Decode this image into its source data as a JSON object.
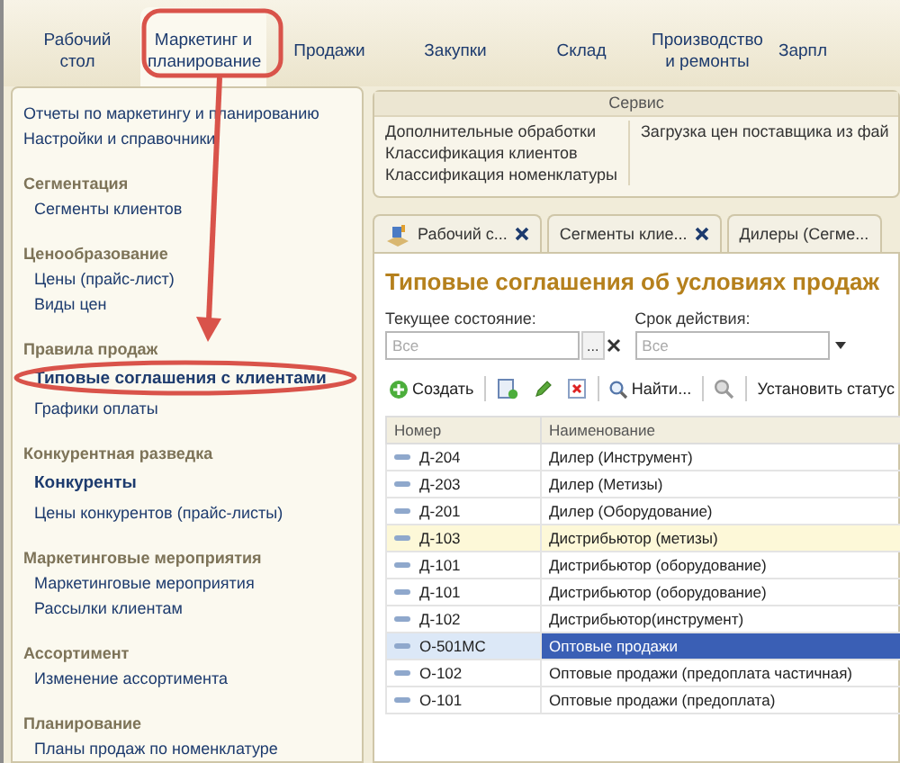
{
  "nav_tabs": [
    {
      "label": "Рабочий\nстол",
      "selected": false
    },
    {
      "label": "Маркетинг и\nпланирование",
      "selected": true
    },
    {
      "label": "Продажи",
      "selected": false
    },
    {
      "label": "Закупки",
      "selected": false
    },
    {
      "label": "Склад",
      "selected": false
    },
    {
      "label": "Производство\nи ремонты",
      "selected": false
    },
    {
      "label": "Зарпл",
      "selected": false
    }
  ],
  "sidebar": {
    "links": [
      "Отчеты по маркетингу и планированию",
      "Настройки и справочники"
    ],
    "groups": [
      {
        "title": "Сегментация",
        "items": [
          {
            "label": "Сегменты клиентов",
            "bold": false
          }
        ]
      },
      {
        "title": "Ценообразование",
        "items": [
          {
            "label": "Цены (прайс-лист)",
            "bold": false
          },
          {
            "label": "Виды цен",
            "bold": false
          }
        ]
      },
      {
        "title": "Правила продаж",
        "items": [
          {
            "label": "Типовые соглашения с клиентами",
            "bold": true
          },
          {
            "label": "Графики оплаты",
            "bold": false
          }
        ]
      },
      {
        "title": "Конкурентная разведка",
        "items": [
          {
            "label": "Конкуренты",
            "bold": true
          },
          {
            "label": "Цены конкурентов (прайс-листы)",
            "bold": false
          }
        ]
      },
      {
        "title": "Маркетинговые мероприятия",
        "items": [
          {
            "label": "Маркетинговые мероприятия",
            "bold": false
          },
          {
            "label": "Рассылки клиентам",
            "bold": false
          }
        ]
      },
      {
        "title": "Ассортимент",
        "items": [
          {
            "label": "Изменение ассортимента",
            "bold": false
          }
        ]
      },
      {
        "title": "Планирование",
        "items": [
          {
            "label": "Планы продаж по номенклатуре",
            "bold": false
          }
        ]
      }
    ]
  },
  "service": {
    "title": "Сервис",
    "columns": [
      [
        "Дополнительные обработки",
        "Классификация клиентов",
        "Классификация номенклатуры"
      ],
      [
        "Загрузка цен поставщика из фай"
      ]
    ]
  },
  "doc_tabs": [
    {
      "label": "Рабочий с...",
      "kind": "home",
      "closable": true
    },
    {
      "label": "Сегменты клие...",
      "kind": "plain",
      "closable": true
    },
    {
      "label": "Дилеры (Сегме...",
      "kind": "plain",
      "closable": false
    }
  ],
  "form": {
    "title": "Типовые соглашения об условиях продаж",
    "filters": [
      {
        "label": "Текущее состояние:",
        "placeholder": "Все",
        "kind": "select-list",
        "button": "..."
      },
      {
        "label": "Срок действия:",
        "placeholder": "Все",
        "kind": "dropdown"
      }
    ],
    "toolbar": [
      {
        "kind": "create",
        "label": "Создать"
      },
      {
        "kind": "copy"
      },
      {
        "kind": "edit"
      },
      {
        "kind": "delete"
      },
      {
        "kind": "find",
        "label": "Найти..."
      },
      {
        "kind": "cancel-find"
      },
      {
        "kind": "text",
        "label": "Установить статус"
      }
    ],
    "table": {
      "columns": [
        "Номер",
        "Наименование"
      ],
      "rows": [
        {
          "number": "Д-204",
          "name": "Дилер (Инструмент)",
          "selected": false,
          "highlighted": false
        },
        {
          "number": "Д-203",
          "name": "Дилер (Метизы)",
          "selected": false,
          "highlighted": false
        },
        {
          "number": "Д-201",
          "name": "Дилер (Оборудование)",
          "selected": false,
          "highlighted": false
        },
        {
          "number": "Д-103",
          "name": "Дистрибьютор (метизы)",
          "selected": false,
          "highlighted": true
        },
        {
          "number": "Д-101",
          "name": "Дистрибьютор (оборудование)",
          "selected": false,
          "highlighted": false
        },
        {
          "number": "Д-101",
          "name": "Дистрибьютор (оборудование)",
          "selected": false,
          "highlighted": false
        },
        {
          "number": "Д-102",
          "name": "Дистрибьютор(инструмент)",
          "selected": false,
          "highlighted": false
        },
        {
          "number": "О-501МС",
          "name": "Оптовые продажи",
          "selected": true,
          "highlighted": false
        },
        {
          "number": "О-102",
          "name": "Оптовые продажи (предоплата частичная)",
          "selected": false,
          "highlighted": false
        },
        {
          "number": "О-101",
          "name": "Оптовые продажи (предоплата)",
          "selected": false,
          "highlighted": false
        }
      ]
    }
  }
}
